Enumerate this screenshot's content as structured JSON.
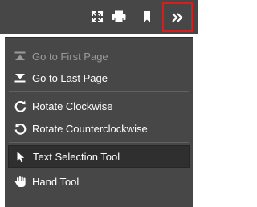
{
  "toolbar": {
    "buttons": [
      {
        "id": "fullscreen",
        "icon": "fullscreen-icon"
      },
      {
        "id": "print",
        "icon": "printer-icon"
      },
      {
        "id": "bookmark",
        "icon": "bookmark-icon"
      },
      {
        "id": "more",
        "icon": "double-chevron-right-icon",
        "highlight_color": "#d41f1f"
      }
    ]
  },
  "menu": {
    "items": [
      {
        "label": "Go to First Page",
        "icon": "first-page-icon",
        "disabled": true
      },
      {
        "label": "Go to Last Page",
        "icon": "last-page-icon",
        "disabled": false
      },
      {
        "label": "Rotate Clockwise",
        "icon": "rotate-clockwise-icon",
        "disabled": false
      },
      {
        "label": "Rotate Counterclockwise",
        "icon": "rotate-counterclockwise-icon",
        "disabled": false
      },
      {
        "label": "Text Selection Tool",
        "icon": "cursor-arrow-icon",
        "disabled": false,
        "selected": true
      },
      {
        "label": "Hand Tool",
        "icon": "hand-icon",
        "disabled": false
      }
    ]
  },
  "colors": {
    "background": "#474747",
    "text": "#ffffff",
    "disabled_text": "#9a9a9a",
    "highlight_border": "#d41f1f"
  }
}
